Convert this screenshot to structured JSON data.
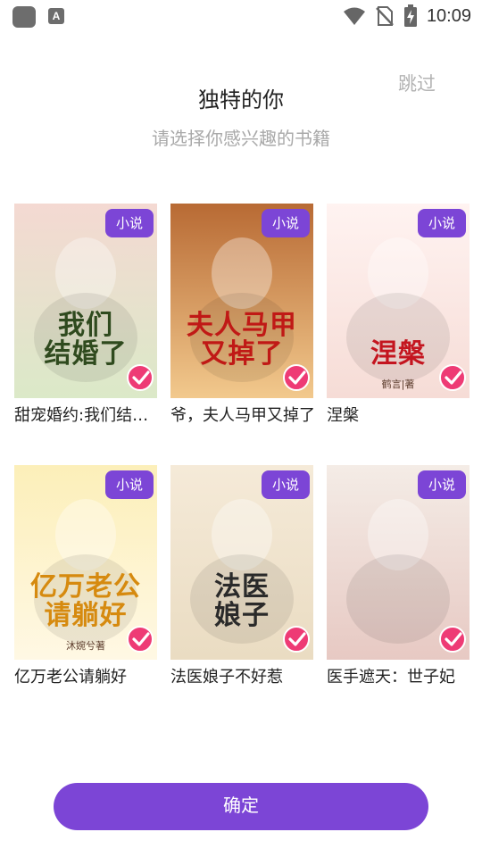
{
  "status_bar": {
    "time": "10:09",
    "a_icon_label": "A",
    "icons": [
      "app-square-icon",
      "a-notification-icon",
      "wifi-icon",
      "no-sim-icon",
      "battery-charging-icon"
    ]
  },
  "header": {
    "skip_label": "跳过",
    "title": "独特的你",
    "subtitle": "请选择你感兴趣的书籍"
  },
  "books": [
    {
      "name": "甜宠婚约:我们结婚了",
      "badge": "小说",
      "cover_title": "我们\n结婚了",
      "cover_author": "",
      "selected": true,
      "colors": [
        "#f4d9d2",
        "#dbe9c8"
      ],
      "title_color": "#2f4a1e"
    },
    {
      "name": "爷，夫人马甲又掉了",
      "badge": "小说",
      "cover_title": "夫人马甲\n又掉了",
      "cover_author": "",
      "selected": true,
      "colors": [
        "#b86a34",
        "#f2c98d"
      ],
      "title_color": "#c01916"
    },
    {
      "name": "涅槃",
      "badge": "小说",
      "cover_title": "涅槃",
      "cover_author": "鹤言|著",
      "selected": true,
      "colors": [
        "#fff3f1",
        "#f6dcd6"
      ],
      "title_color": "#c4151f"
    },
    {
      "name": "亿万老公请躺好",
      "badge": "小说",
      "cover_title": "亿万老公\n请躺好",
      "cover_author": "沐婉兮著",
      "selected": true,
      "colors": [
        "#fcefb9",
        "#fff8e4"
      ],
      "title_color": "#d68a0f"
    },
    {
      "name": "法医娘子不好惹",
      "badge": "小说",
      "cover_title": "法医\n娘子",
      "cover_author": "",
      "selected": true,
      "colors": [
        "#f5ead8",
        "#eadcc2"
      ],
      "title_color": "#2a2a2a"
    },
    {
      "name": "医手遮天：世子妃",
      "badge": "小说",
      "cover_title": "",
      "cover_author": "",
      "selected": true,
      "colors": [
        "#f4ece6",
        "#e7c9c3"
      ],
      "title_color": "#7a1d1d"
    }
  ],
  "confirm_label": "确定",
  "theme": {
    "accent": "#7c45d6",
    "check": "#ee3b75"
  }
}
